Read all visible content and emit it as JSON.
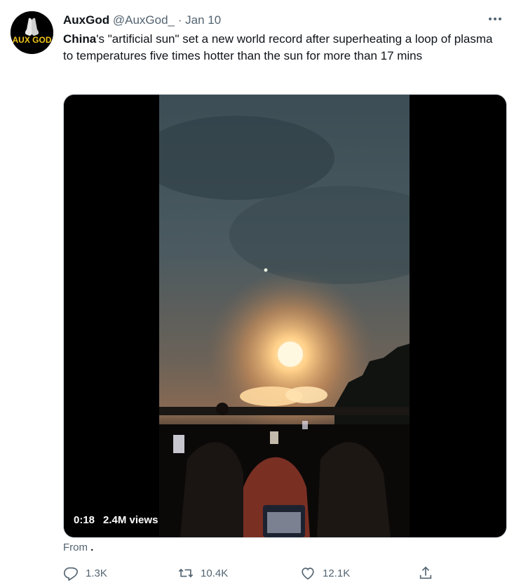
{
  "author": {
    "name": "AuxGod",
    "handle": "@AuxGod_",
    "separator": "·",
    "date": "Jan 10",
    "avatar_text": "AUX GOD"
  },
  "tweet": {
    "text_bold": "China",
    "text_rest": "'s \"artificial sun\" set a new world record after superheating a loop of plasma to temperatures five times hotter than the sun for more than 17 mins"
  },
  "video": {
    "duration": "0:18",
    "views": "2.4M views"
  },
  "from": {
    "label": "From",
    "source": "."
  },
  "actions": {
    "replies": "1.3K",
    "retweets": "10.4K",
    "likes": "12.1K"
  },
  "icons": {
    "more": "more-icon",
    "reply": "reply-icon",
    "retweet": "retweet-icon",
    "like": "heart-icon",
    "share": "share-icon"
  },
  "colors": {
    "text": "#0f1419",
    "secondary": "#536471",
    "border": "#cfd9de",
    "avatar_text": "#f0c419"
  }
}
